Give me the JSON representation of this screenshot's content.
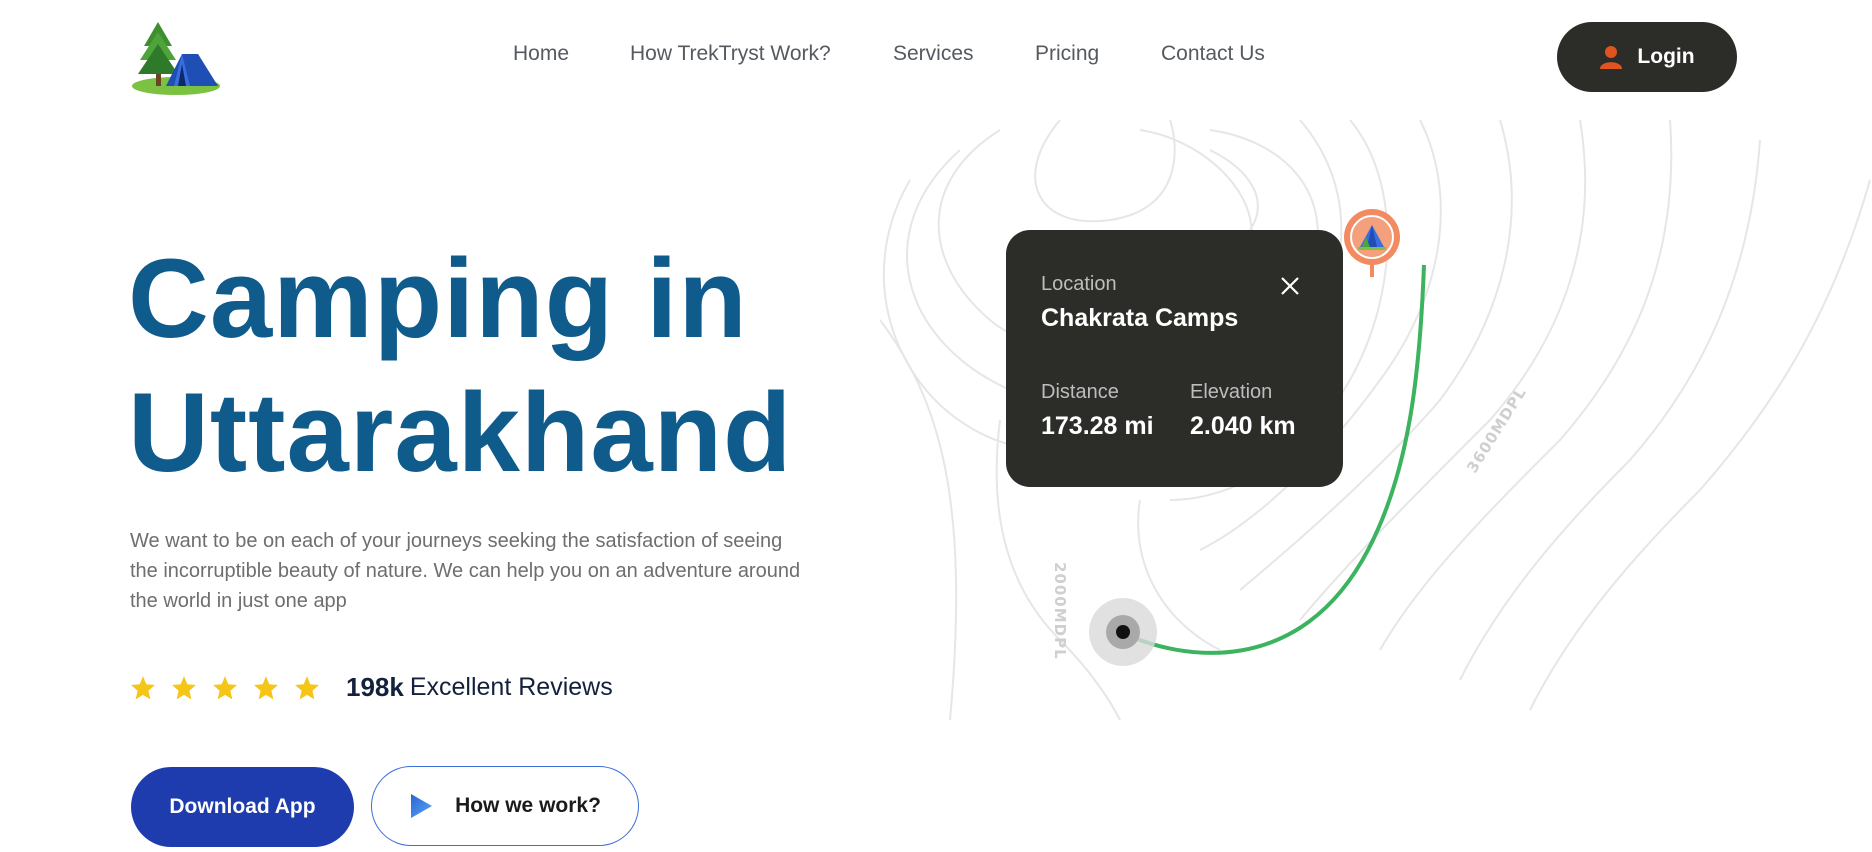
{
  "brand": {
    "logo_icon": "camping-tent-tree-logo"
  },
  "nav": {
    "items": [
      {
        "label": "Home"
      },
      {
        "label": "How TrekTryst Work?"
      },
      {
        "label": "Services"
      },
      {
        "label": "Pricing"
      },
      {
        "label": "Contact Us"
      }
    ],
    "login_label": "Login",
    "login_icon": "user-icon"
  },
  "hero": {
    "title_line1": "Camping in",
    "title_line2": "Uttarakhand",
    "description": "We want to be on each of your journeys seeking the satisfaction of seeing the incorruptible beauty of nature. We can help you on an adventure around the world in just one app",
    "rating": {
      "stars": 5,
      "count": "198k",
      "label": "Excellent Reviews"
    },
    "download_label": "Download App",
    "how_label": "How we work?"
  },
  "map": {
    "contour_label_1": "3600MDPL",
    "contour_label_2": "2000MDPL",
    "card": {
      "location_label": "Location",
      "location_value": "Chakrata Camps",
      "distance_label": "Distance",
      "distance_value": "173.28 mi",
      "elevation_label": "Elevation",
      "elevation_value": "2.040 km"
    },
    "colors": {
      "route": "#3cb35f",
      "pin": "#f28b61",
      "card": "#2c2d29"
    }
  },
  "colors": {
    "title": "#0f5c8c",
    "primary_button": "#1f3caf",
    "dark": "#2c2d29",
    "star": "#f5c518"
  }
}
